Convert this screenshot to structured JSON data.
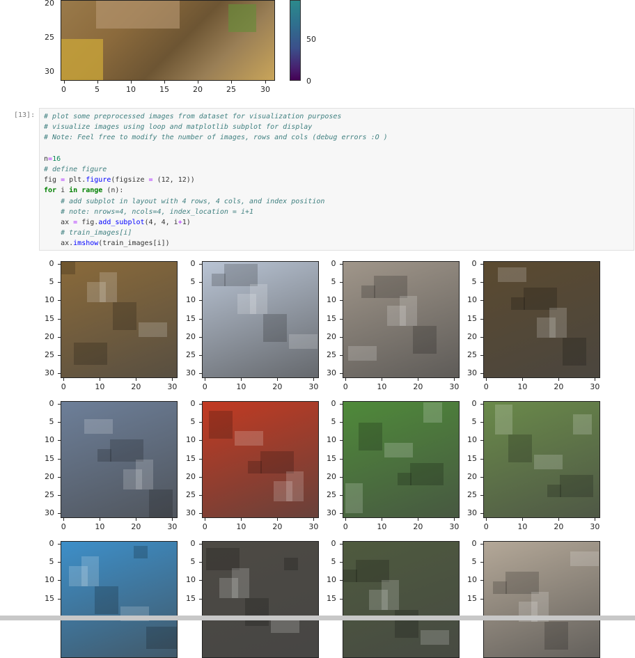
{
  "top_plot": {
    "y_ticks": [
      "20",
      "25",
      "30"
    ],
    "x_ticks": [
      "0",
      "5",
      "10",
      "15",
      "20",
      "25",
      "30"
    ],
    "colorbar_ticks": [
      "50",
      "0"
    ]
  },
  "cell": {
    "prompt": "[13]:",
    "lines": [
      {
        "parts": [
          {
            "t": "# plot some preprocessed images from dataset for visualization purposes",
            "c": "cm"
          }
        ]
      },
      {
        "parts": [
          {
            "t": "# visualize images using loop and matplotlib subplot for display",
            "c": "cm"
          }
        ]
      },
      {
        "parts": [
          {
            "t": "# Note: Feel free to modify the number of images, rows and cols (debug errors :O )",
            "c": "cm"
          }
        ]
      },
      {
        "parts": [
          {
            "t": "",
            "c": ""
          }
        ]
      },
      {
        "parts": [
          {
            "t": "n",
            "c": ""
          },
          {
            "t": "=",
            "c": "op"
          },
          {
            "t": "16",
            "c": "num"
          }
        ]
      },
      {
        "parts": [
          {
            "t": "# define figure",
            "c": "cm"
          }
        ]
      },
      {
        "parts": [
          {
            "t": "fig ",
            "c": ""
          },
          {
            "t": "=",
            "c": "op"
          },
          {
            "t": " plt.",
            "c": ""
          },
          {
            "t": "figure",
            "c": "fn"
          },
          {
            "t": "(figsize ",
            "c": ""
          },
          {
            "t": "=",
            "c": "op"
          },
          {
            "t": " (12, 12))",
            "c": ""
          }
        ]
      },
      {
        "parts": [
          {
            "t": "for",
            "c": "kw"
          },
          {
            "t": " i ",
            "c": ""
          },
          {
            "t": "in",
            "c": "kw"
          },
          {
            "t": " ",
            "c": ""
          },
          {
            "t": "range",
            "c": "kw"
          },
          {
            "t": " (n):",
            "c": ""
          }
        ]
      },
      {
        "parts": [
          {
            "t": "    # add subplot in layout with 4 rows, 4 cols, and index position",
            "c": "cm"
          }
        ]
      },
      {
        "parts": [
          {
            "t": "    # note: nrows=4, ncols=4, index_location = i+1",
            "c": "cm"
          }
        ]
      },
      {
        "parts": [
          {
            "t": "    ax ",
            "c": ""
          },
          {
            "t": "=",
            "c": "op"
          },
          {
            "t": " fig.",
            "c": ""
          },
          {
            "t": "add_subplot",
            "c": "fn"
          },
          {
            "t": "(4, 4, i",
            "c": ""
          },
          {
            "t": "+",
            "c": "op"
          },
          {
            "t": "1)",
            "c": ""
          }
        ]
      },
      {
        "parts": [
          {
            "t": "    # train_images[i]",
            "c": "cm"
          }
        ]
      },
      {
        "parts": [
          {
            "t": "    ax.",
            "c": ""
          },
          {
            "t": "imshow",
            "c": "fn"
          },
          {
            "t": "(train_images[i])",
            "c": ""
          }
        ]
      }
    ]
  },
  "grid": {
    "y_ticks": [
      "0",
      "5",
      "10",
      "15",
      "20",
      "25",
      "30"
    ],
    "x_ticks": [
      "0",
      "10",
      "20",
      "30"
    ],
    "images": [
      {
        "name": "frog",
        "bg": "#8a6a3a"
      },
      {
        "name": "truck",
        "bg": "#b9c4d4"
      },
      {
        "name": "dump-truck",
        "bg": "#a0968a"
      },
      {
        "name": "deer",
        "bg": "#5b4a30"
      },
      {
        "name": "car",
        "bg": "#6d7f99"
      },
      {
        "name": "red-car",
        "bg": "#c23a22"
      },
      {
        "name": "bird",
        "bg": "#4f8a3a"
      },
      {
        "name": "horse",
        "bg": "#6a8a4a"
      },
      {
        "name": "ship",
        "bg": "#3d8fc9"
      },
      {
        "name": "cat",
        "bg": "#4d4a44"
      },
      {
        "name": "deer-2",
        "bg": "#4e5a3e"
      },
      {
        "name": "horse-rider",
        "bg": "#b4a898"
      }
    ]
  }
}
